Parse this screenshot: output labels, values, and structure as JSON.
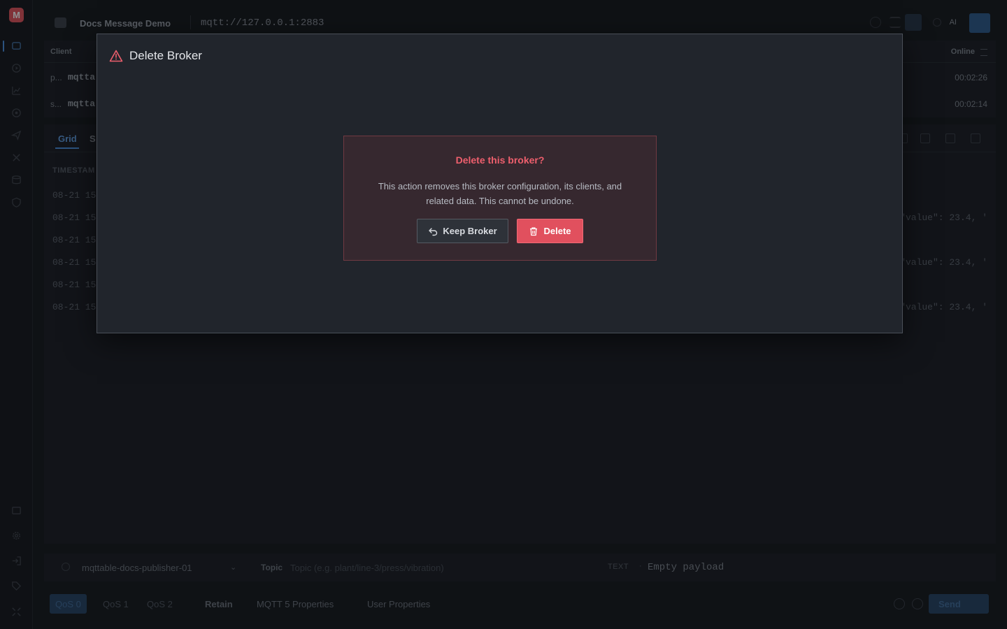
{
  "app": {
    "logo_letter": "M",
    "connection_name": "Docs Message Demo",
    "connection_url": "mqtt://127.0.0.1:2883",
    "ai_label": "AI"
  },
  "clients": {
    "header_client": "Client",
    "header_online": "Online",
    "rows": [
      {
        "prefix": "p...",
        "name": "mqtta",
        "online": "00:02:26"
      },
      {
        "prefix": "s...",
        "name": "mqtta",
        "online": "00:02:14"
      }
    ]
  },
  "grid": {
    "tab_grid": "Grid",
    "tab_second": "S",
    "header_timestamp": "TIMESTAM",
    "rows": [
      {
        "ts": "08-21 15:",
        "payload": ""
      },
      {
        "ts": "08-21 15:",
        "payload": "\"value\": 23.4, '"
      },
      {
        "ts": "08-21 15:",
        "payload": ""
      },
      {
        "ts": "08-21 15:",
        "payload": "\"value\": 23.4, '"
      },
      {
        "ts": "08-21 15:",
        "payload": ""
      },
      {
        "ts": "08-21 15:",
        "payload": "\"value\": 23.4, '"
      }
    ]
  },
  "composer": {
    "client": "mqttable-docs-publisher-01",
    "topic_label": "Topic",
    "topic_placeholder": "Topic (e.g. plant/line-3/press/vibration)",
    "format": "TEXT",
    "payload_placeholder": "Empty payload"
  },
  "options": {
    "qos": [
      "QoS 0",
      "QoS 1",
      "QoS 2"
    ],
    "retain": "Retain",
    "mqtt5": "MQTT 5 Properties",
    "user_props": "User Properties",
    "send": "Send"
  },
  "modal": {
    "title": "Delete Broker",
    "confirm_title": "Delete this broker?",
    "confirm_message": "This action removes this broker configuration, its clients, and related data. This cannot be undone.",
    "keep_label": "Keep Broker",
    "delete_label": "Delete"
  },
  "colors": {
    "danger": "#e1505e",
    "accent": "#4a8fdc",
    "modal_bg": "#21252c"
  },
  "icons": [
    "warning-icon",
    "undo-icon",
    "trash-icon"
  ]
}
